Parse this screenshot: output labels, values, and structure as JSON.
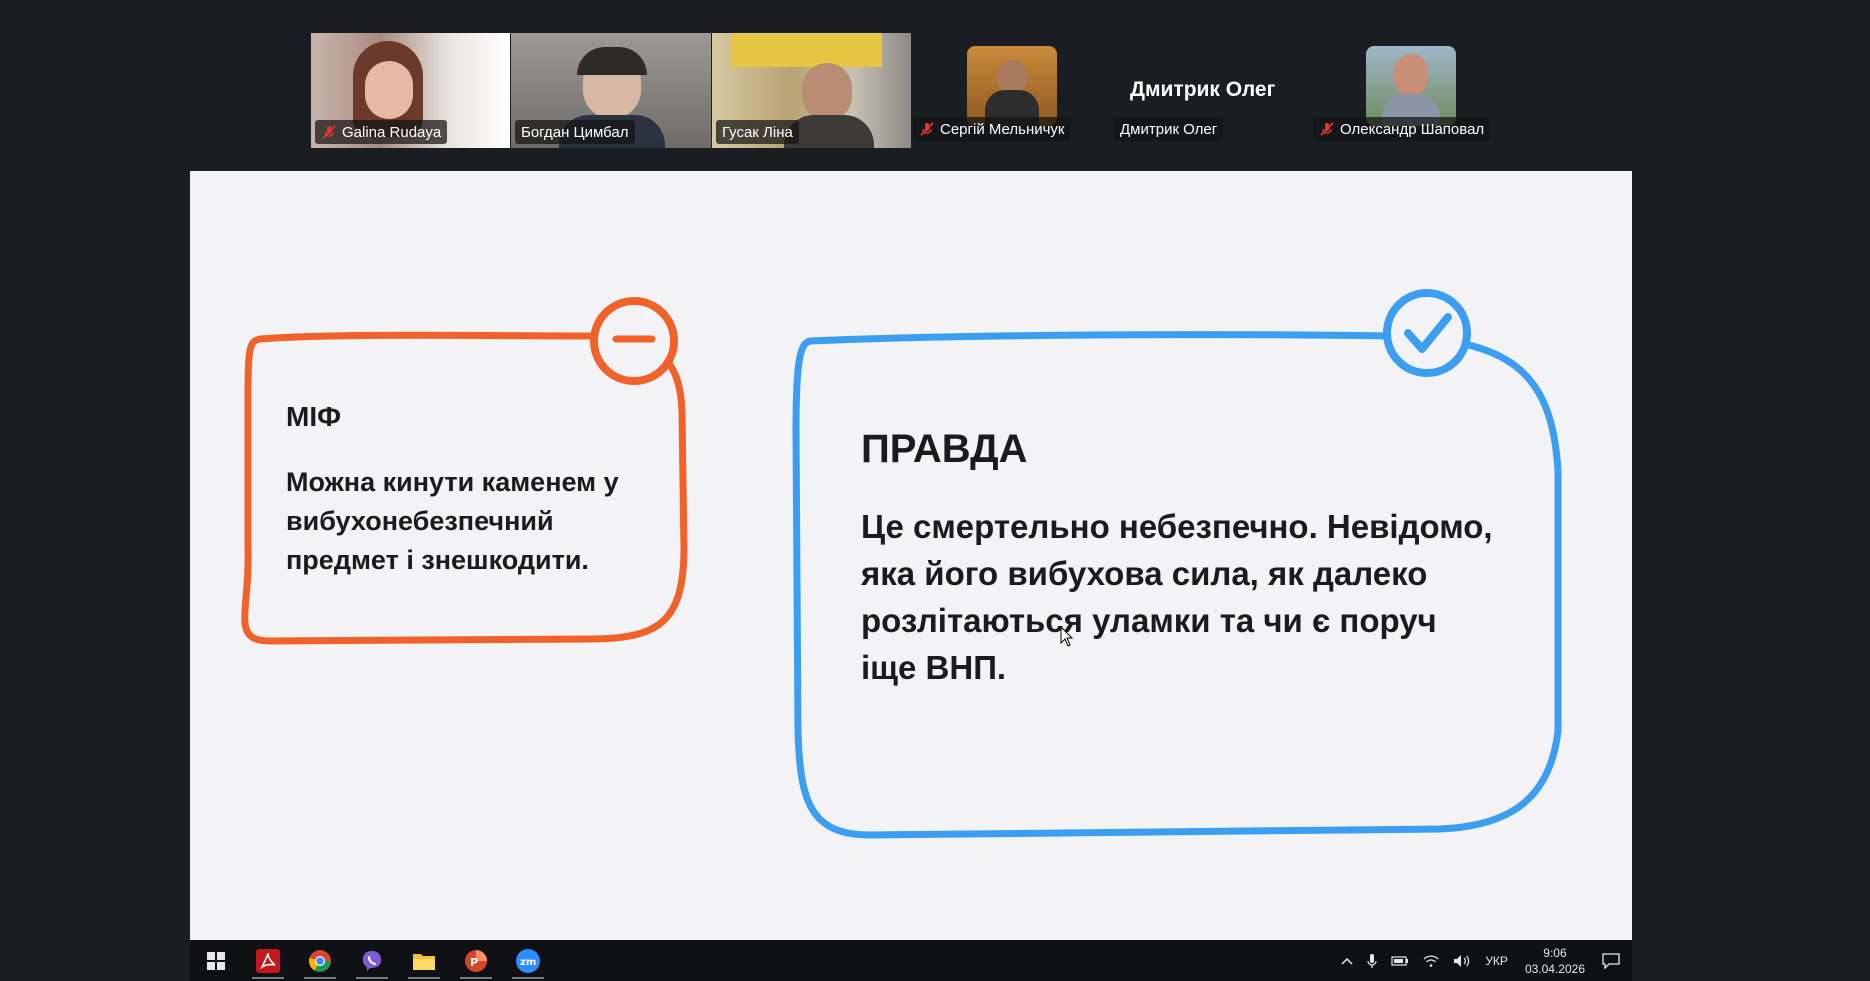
{
  "participants": [
    {
      "name": "Galina Rudaya",
      "muted": true
    },
    {
      "name": "Богдан Цимбал",
      "muted": false,
      "active": true
    },
    {
      "name": "Гусак Ліна",
      "muted": false
    },
    {
      "name": "Сергій Мельничук",
      "muted": true
    },
    {
      "name": "Дмитрик Олег",
      "muted": false,
      "video": false
    },
    {
      "name": "Олександр Шаповал",
      "muted": true
    }
  ],
  "name_only_header": "Дмитрик Олег",
  "slide": {
    "myth": {
      "title": "МІФ",
      "text": "Можна кинути каменем у вибухонебезпечний предмет і знешкодити.",
      "color": "#f0622a"
    },
    "truth": {
      "title": "ПРАВДА",
      "text": "Це смертельно небезпечно. Невідомо, яка його вибухова сила, як далеко розлітаються уламки та чи є поруч іще ВНП.",
      "color": "#3c9ef0"
    }
  },
  "taskbar": {
    "apps": [
      "start-icon",
      "acrobat-icon",
      "chrome-icon",
      "viber-icon",
      "file-explorer-icon",
      "powerpoint-icon",
      "zoom-icon"
    ],
    "tray": {
      "language": "УКР",
      "time": "9:06",
      "date": "03.04.2026"
    }
  }
}
